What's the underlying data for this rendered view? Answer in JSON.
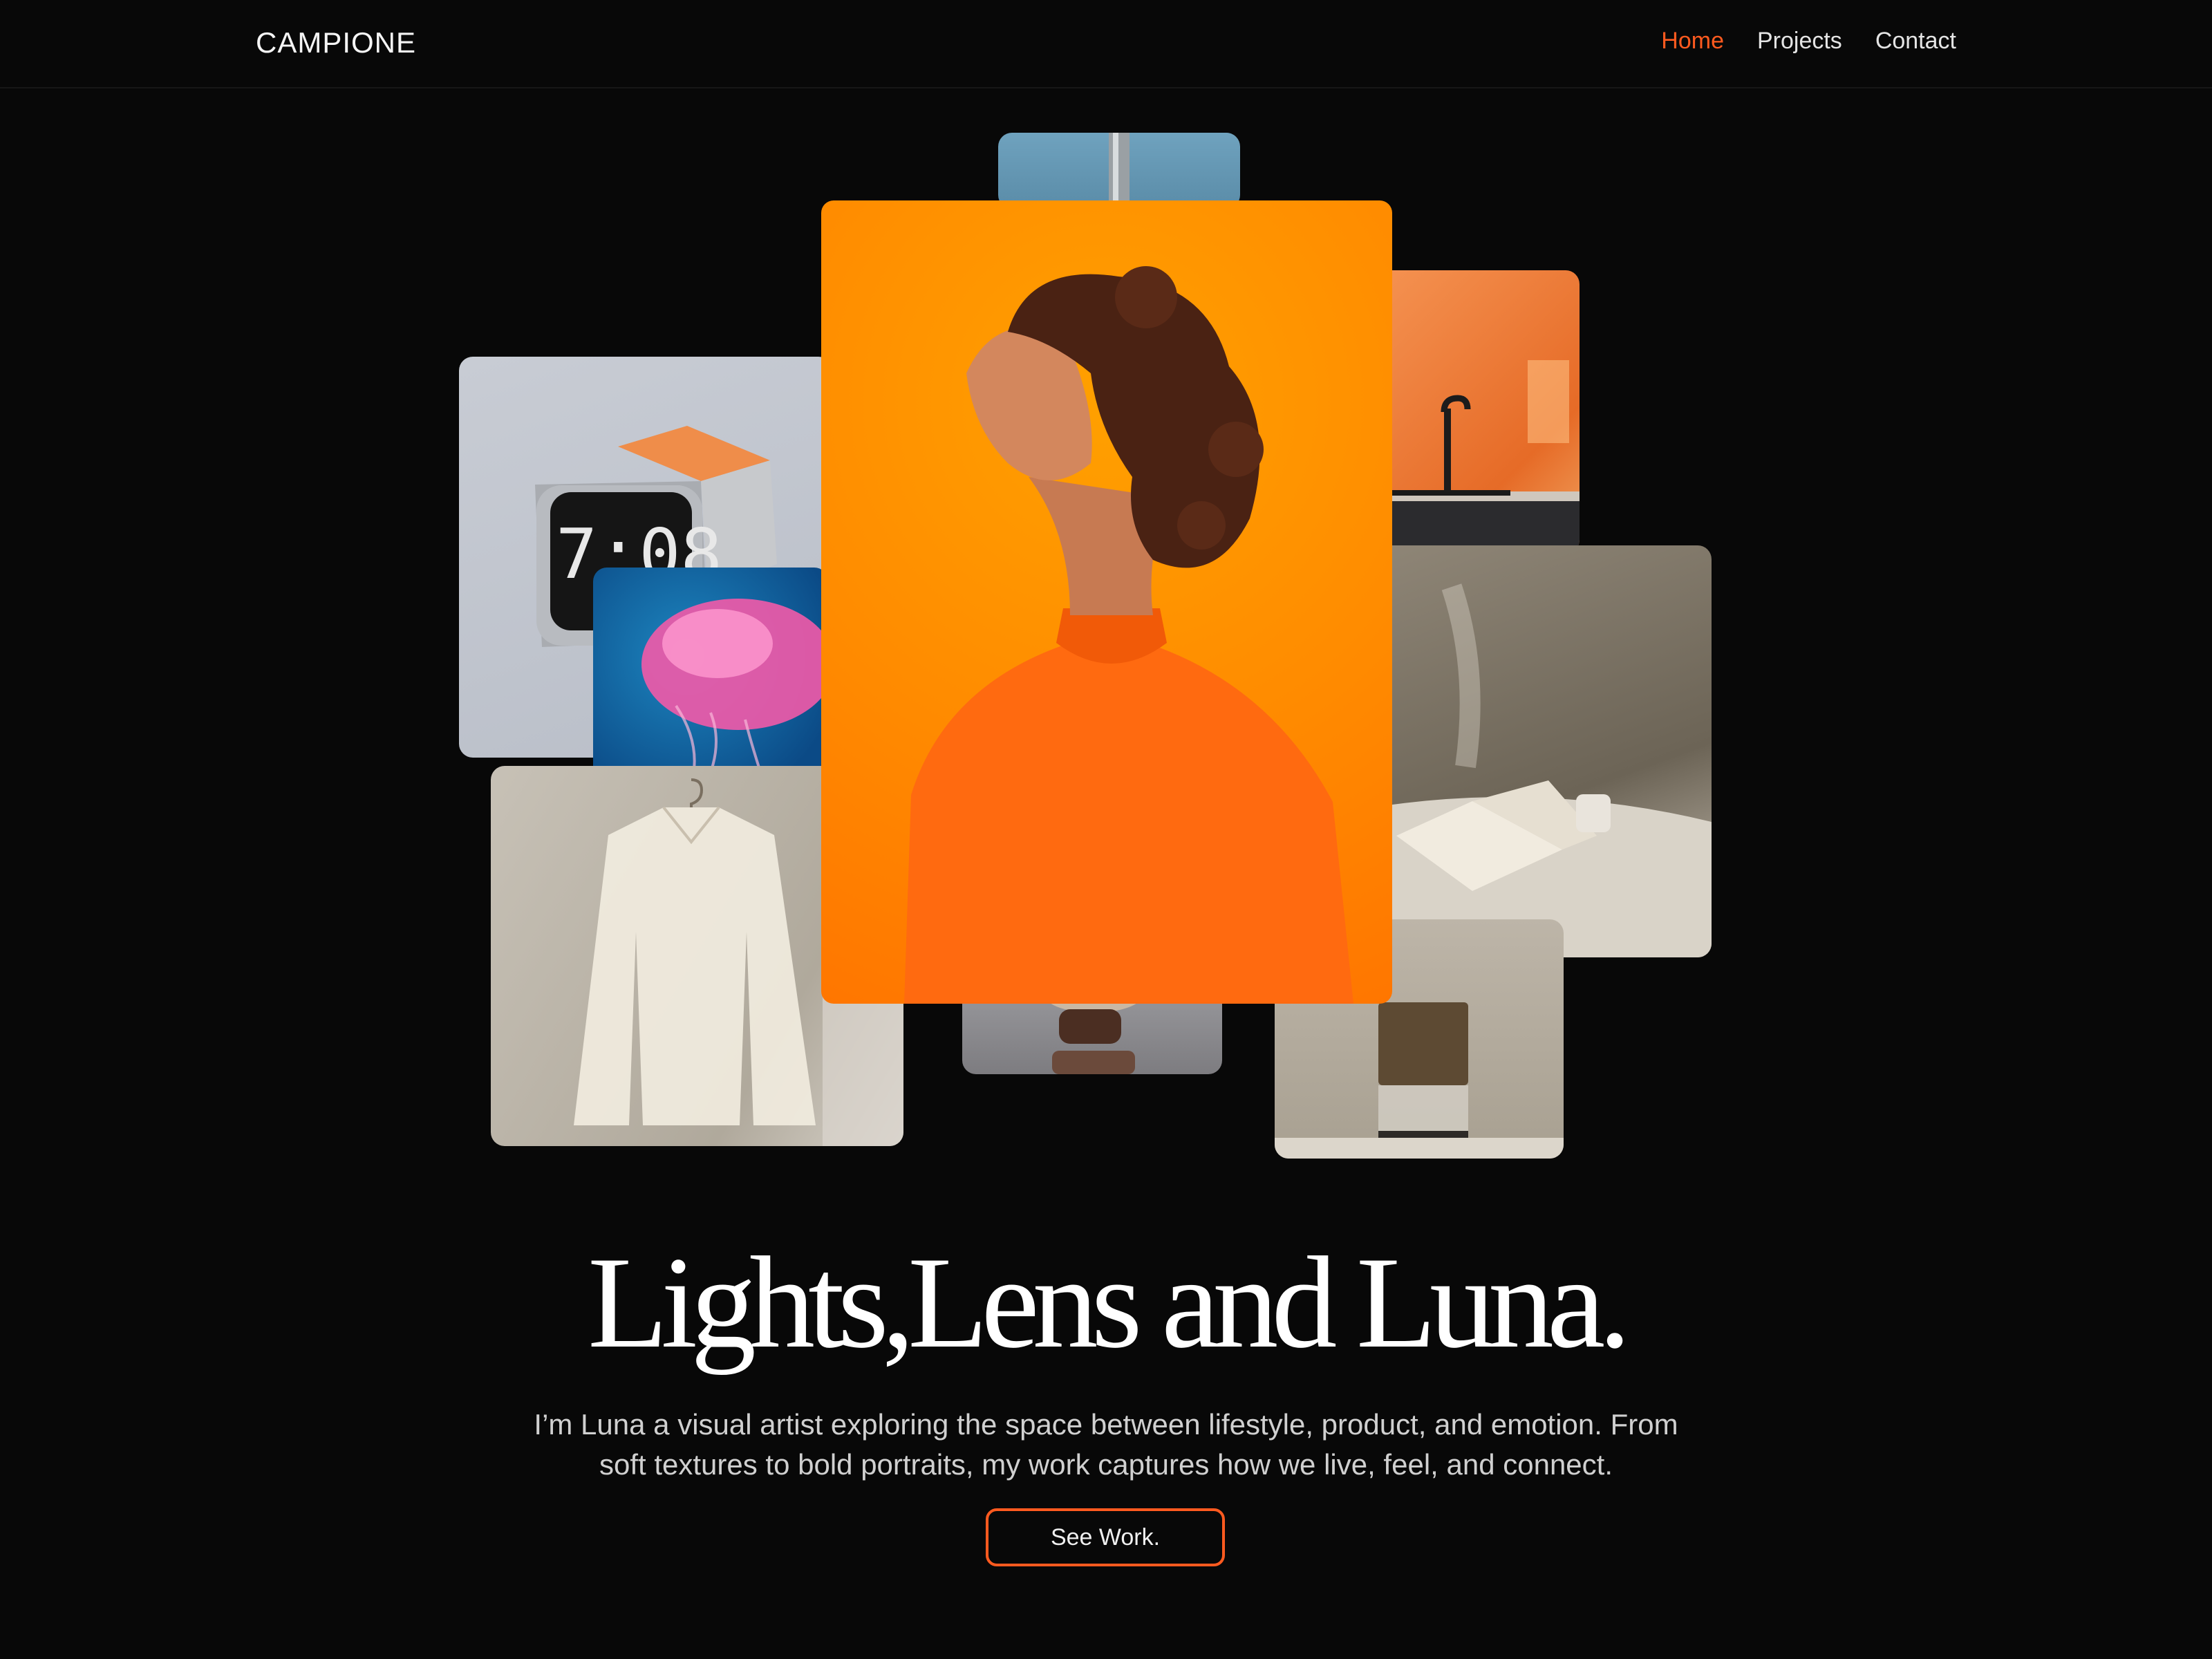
{
  "nav": {
    "brand": "CAMPIONE",
    "links": [
      {
        "label": "Home",
        "active": true
      },
      {
        "label": "Projects",
        "active": false
      },
      {
        "label": "Contact",
        "active": false
      }
    ]
  },
  "collage": {
    "clock_display": "7:08"
  },
  "hero": {
    "title": "Lights,Lens and Luna.",
    "subtitle_line1": "I’m Luna  a visual artist exploring the space between lifestyle, product, and emotion. From",
    "subtitle_line2": "soft textures to bold portraits, my work captures how we live, feel, and connect.",
    "cta_label": "See Work."
  },
  "colors": {
    "background": "#080808",
    "accent": "#ff5a1f",
    "portrait_orange": "#ff8a00"
  }
}
